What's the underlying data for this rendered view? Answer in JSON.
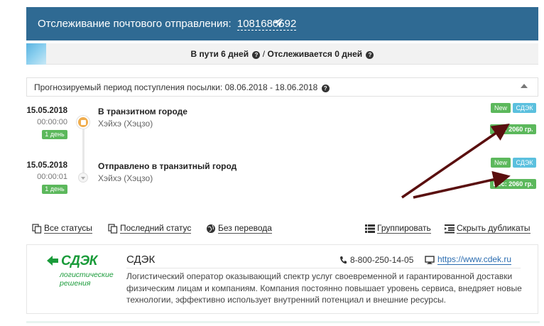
{
  "header": {
    "title": "Отслеживание почтового отправления:",
    "track_number": "1081680592",
    "bg_color": "#2f6a93"
  },
  "days": {
    "in_transit": "В пути 6 дней",
    "separator": "/",
    "tracked": "Отслеживается 0 дней"
  },
  "forecast": {
    "text": "Прогнозируемый период поступления посылки: 08.06.2018 - 18.06.2018"
  },
  "events": [
    {
      "date": "15.05.2018",
      "time": "00:00:00",
      "duration": "1 день",
      "status": "В транзитном городе",
      "place": "Хэйхэ (Хэцзо)",
      "new_label": "New",
      "carrier": "СДЭК",
      "weight": "Вес: 2060 гр."
    },
    {
      "date": "15.05.2018",
      "time": "00:00:01",
      "duration": "1 день",
      "status": "Отправлено в транзитный город",
      "place": "Хэйхэ (Хэцзо)",
      "new_label": "New",
      "carrier": "СДЭК",
      "weight": "Вес: 2060 гр."
    }
  ],
  "actions": {
    "all_statuses": "Все статусы",
    "last_status": "Последний статус",
    "no_translation": "Без перевода",
    "group": "Группировать",
    "hide_duplicates": "Скрыть дубликаты"
  },
  "carrier_card": {
    "logo_text": "СДЭК",
    "logo_sub_1": "логистические",
    "logo_sub_2": "решения",
    "name": "СДЭК",
    "phone": "8-800-250-14-05",
    "website": "https://www.cdek.ru",
    "description": "Логистический оператор оказывающий спектр услуг своевременной и гарантированной доставки физическим лицам и компаниям. Компания постоянно повышает уровень сервиса, внедряет новые технологии, эффективно использует внутренний потенциал и внешние ресурсы.",
    "brand_color": "#1a9b3a"
  },
  "colors": {
    "success": "#5cb85c",
    "info": "#5bc0de",
    "warning": "#f0ad4e",
    "annotation_arrow": "#5a0f0f"
  },
  "icons": {
    "send": "paper-plane-icon",
    "question": "question-circle-icon",
    "timeline_first": "package-icon",
    "timeline_second": "chevron-down-icon",
    "all_statuses": "copy-icon",
    "last_status": "copy-icon",
    "no_translation": "globe-icon",
    "group": "list-icon",
    "hide_duplicates": "collapse-list-icon",
    "phone": "phone-icon",
    "website": "desktop-icon"
  }
}
